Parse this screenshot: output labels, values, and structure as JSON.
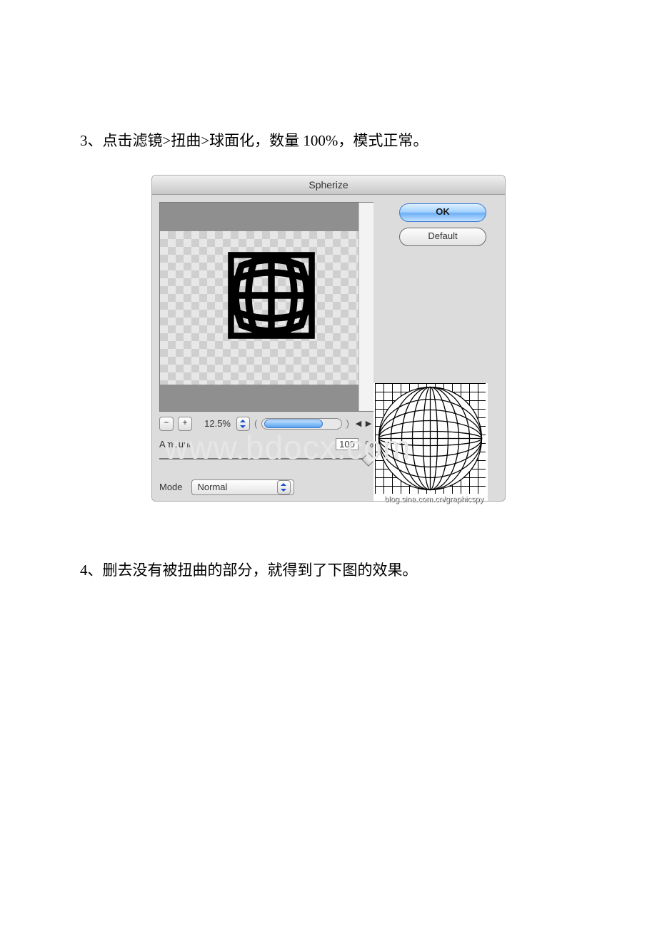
{
  "step3_text": "3、点击滤镜>扭曲>球面化，数量 100%，模式正常。",
  "step4_text": "4、删去没有被扭曲的部分，就得到了下图的效果。",
  "dialog": {
    "title": "Spherize",
    "ok": "OK",
    "default": "Default",
    "zoom_minus": "−",
    "zoom_plus": "+",
    "zoom_value": "12.5%",
    "arrow_left": "◀",
    "arrow_right": "▶",
    "amount_label": "Amount",
    "amount_value": "100",
    "amount_unit": "%",
    "mode_label": "Mode",
    "mode_value": "Normal",
    "credit": "blog.sina.com.cn/graphicspy"
  },
  "watermark": "www.bdocx.com"
}
